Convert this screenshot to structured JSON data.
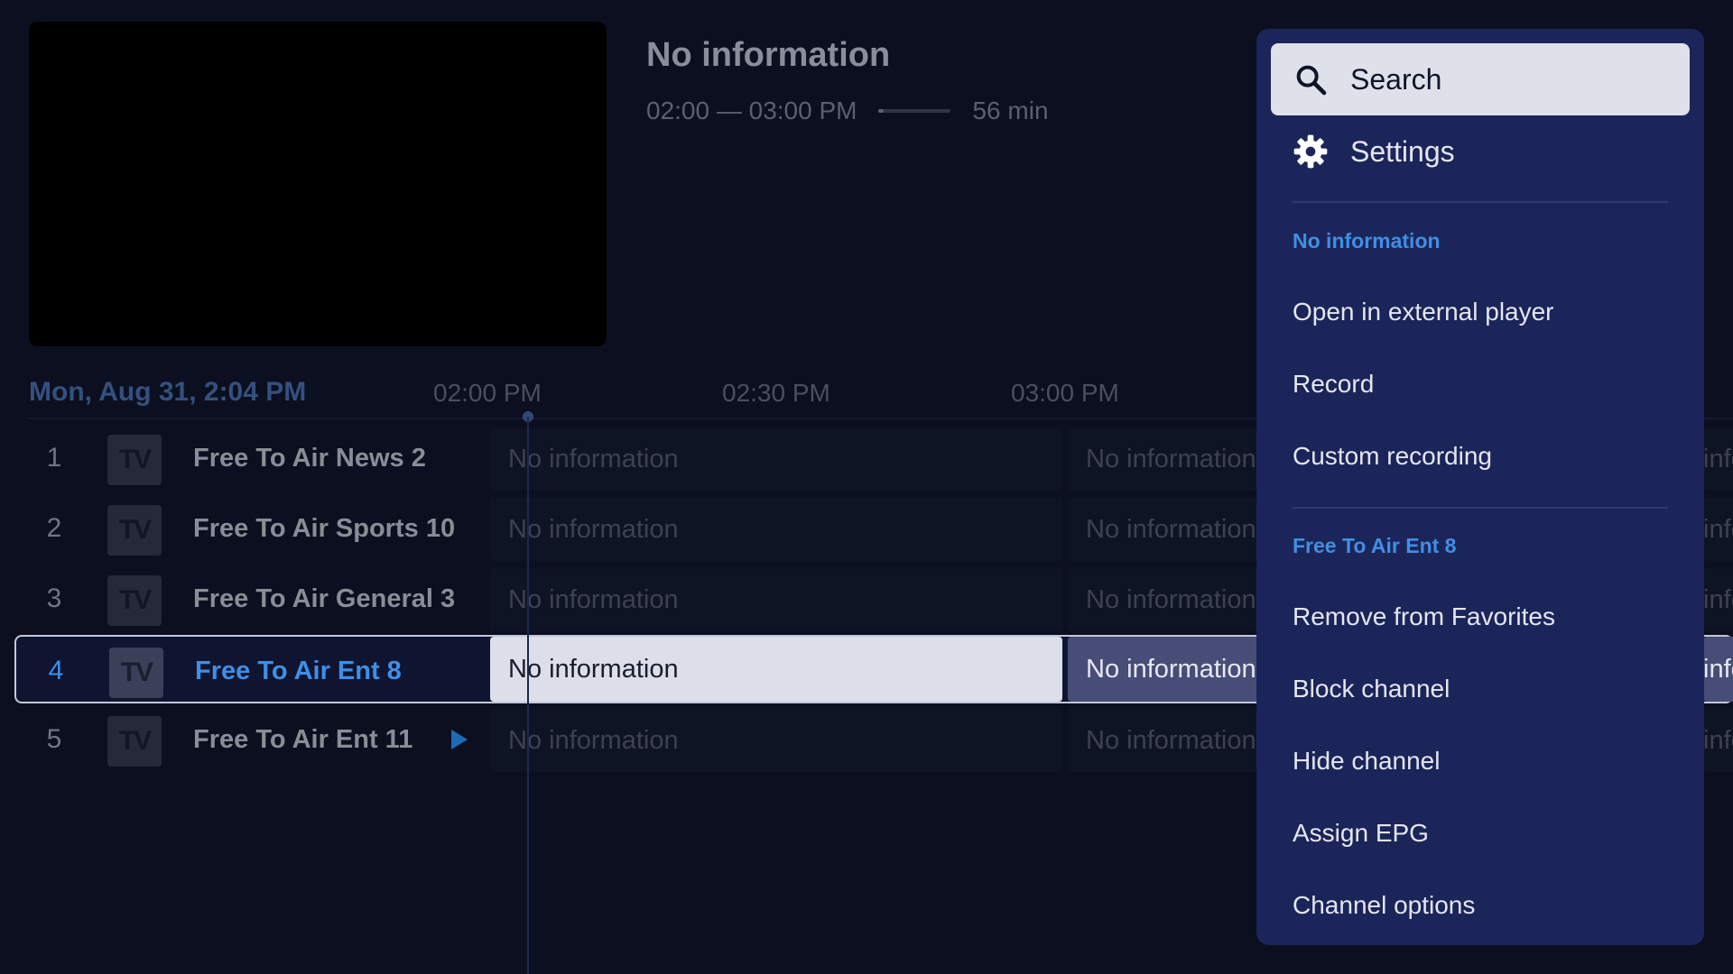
{
  "program": {
    "title": "No information",
    "time_range": "02:00 — 03:00 PM",
    "duration": "56 min",
    "progress": 0.07
  },
  "timeline": {
    "date": "Mon, Aug 31, 2:04 PM",
    "ticks": [
      "02:00 PM",
      "02:30 PM",
      "03:00 PM"
    ]
  },
  "channels": [
    {
      "number": "1",
      "logo": "TV",
      "name": "Free To Air News 2",
      "programs": [
        "No information",
        "No information",
        "information"
      ]
    },
    {
      "number": "2",
      "logo": "TV",
      "name": "Free To Air Sports 10",
      "programs": [
        "No information",
        "No information",
        "information"
      ]
    },
    {
      "number": "3",
      "logo": "TV",
      "name": "Free To Air General 3",
      "programs": [
        "No information",
        "No information",
        "information"
      ]
    },
    {
      "number": "4",
      "logo": "TV",
      "name": "Free To Air Ent 8",
      "programs": [
        "No information",
        "No information",
        "information"
      ]
    },
    {
      "number": "5",
      "logo": "TV",
      "name": "Free To Air Ent 11",
      "programs": [
        "No information",
        "No information",
        "information"
      ]
    }
  ],
  "menu": {
    "search_label": "Search",
    "settings_label": "Settings",
    "program_section": "No information",
    "program_items": [
      "Open in external player",
      "Record",
      "Custom recording"
    ],
    "channel_section": "Free To Air Ent 8",
    "channel_items": [
      "Remove from Favorites",
      "Block channel",
      "Hide channel",
      "Assign EPG",
      "Channel options"
    ]
  },
  "colors": {
    "background": "#0b0f20",
    "accent": "#3f8fe6",
    "menu_bg": "#1c2559"
  }
}
